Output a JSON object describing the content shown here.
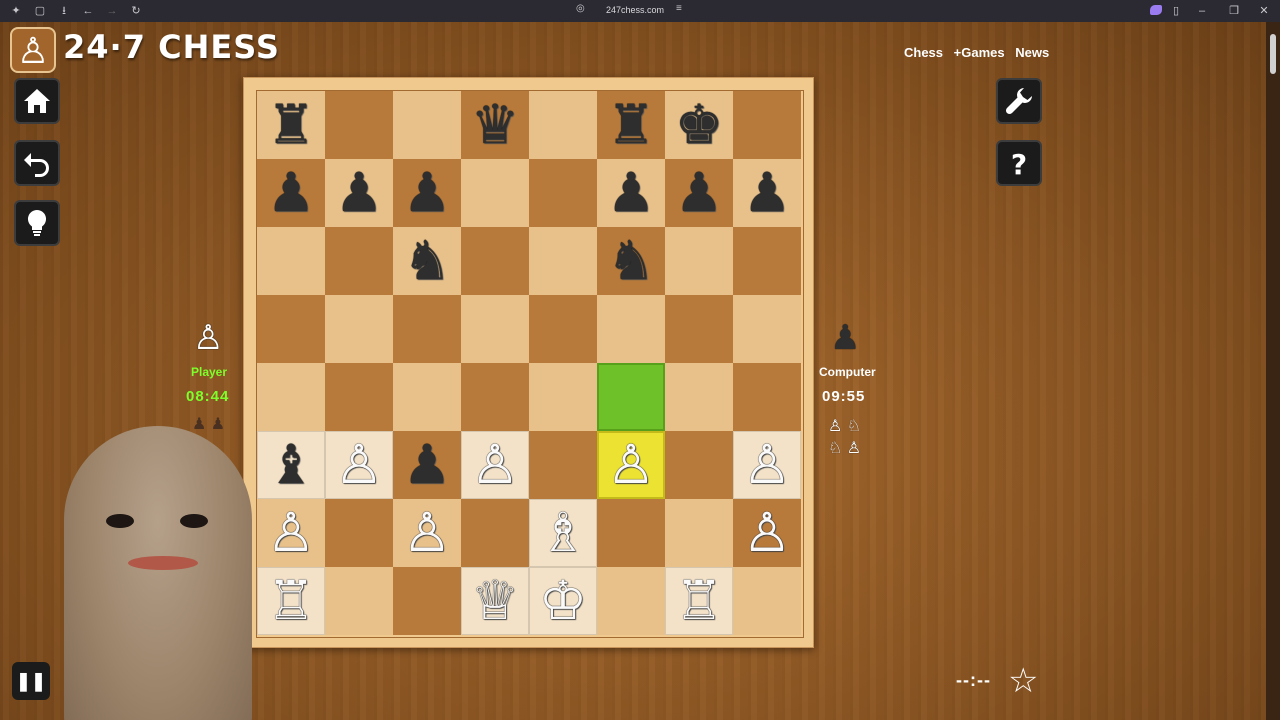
{
  "browser": {
    "url": "247chess.com"
  },
  "header": {
    "logo_text": "24·7 CHESS",
    "nav": [
      "Chess",
      "+Games",
      "News"
    ]
  },
  "player": {
    "name": "Player",
    "clock": "08:44",
    "name_color": "#7cff2a",
    "captured": [
      "♟",
      "♟"
    ]
  },
  "computer": {
    "name": "Computer",
    "clock": "09:55",
    "captured": [
      "♙",
      "♘",
      "♘",
      "♙"
    ]
  },
  "footer": {
    "score": "--:--"
  },
  "colors": {
    "highlight_from": "#6fc12a",
    "highlight_to": "#ebe232",
    "light_square": "#e8c18a",
    "dark_square": "#b87a3a"
  },
  "board": {
    "rows": [
      [
        "♜",
        "",
        "",
        "♛",
        "",
        "♜",
        "♚",
        ""
      ],
      [
        "♟",
        "♟",
        "♟",
        "",
        "",
        "♟",
        "♟",
        "♟"
      ],
      [
        "",
        "",
        "♞",
        "",
        "",
        "♞",
        "",
        ""
      ],
      [
        "",
        "",
        "",
        "",
        "",
        "",
        "",
        ""
      ],
      [
        "",
        "",
        "",
        "",
        "",
        "",
        "",
        ""
      ],
      [
        "♝",
        "♙",
        "♟",
        "♙",
        "",
        "♙",
        "",
        "♙"
      ],
      [
        "♙",
        "",
        "♙",
        "",
        "♗",
        "",
        "",
        "♙"
      ],
      [
        "♖",
        "",
        "",
        "♕",
        "♔",
        "",
        "♖",
        ""
      ]
    ],
    "from_square": "f4",
    "to_square": "f3"
  }
}
